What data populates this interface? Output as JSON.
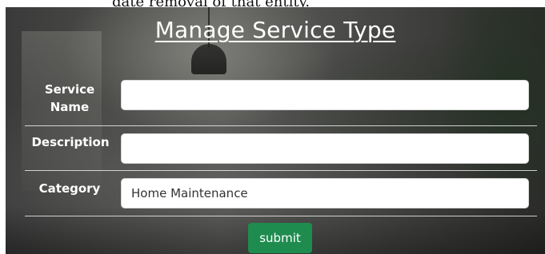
{
  "page": {
    "top_text": "date removal of that entity."
  },
  "form": {
    "title": "Manage Service Type",
    "service_name": {
      "label_line1": "Service",
      "label_line2": "Name",
      "value": ""
    },
    "description": {
      "label": "Description",
      "value": ""
    },
    "category": {
      "label": "Category",
      "value": "Home Maintenance"
    },
    "submit_label": "submit"
  },
  "colors": {
    "submit_button": "#1e8c4e",
    "label_text": "#ffffff"
  }
}
